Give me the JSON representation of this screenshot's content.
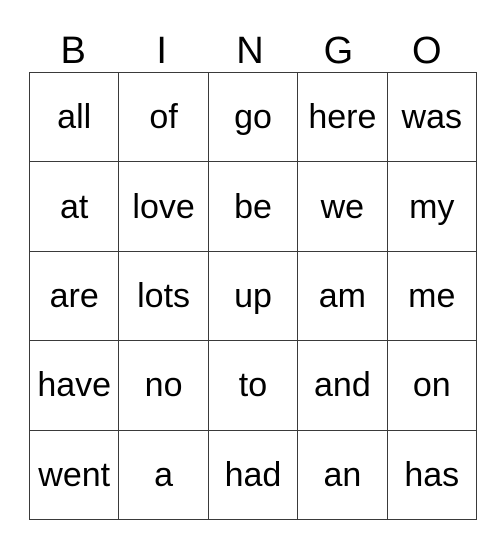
{
  "card": {
    "title": "BINGO",
    "column_headers": [
      "B",
      "I",
      "N",
      "G",
      "O"
    ],
    "rows": [
      [
        "all",
        "of",
        "go",
        "here",
        "was"
      ],
      [
        "at",
        "love",
        "be",
        "we",
        "my"
      ],
      [
        "are",
        "lots",
        "up",
        "am",
        "me"
      ],
      [
        "have",
        "no",
        "to",
        "and",
        "on"
      ],
      [
        "went",
        "a",
        "had",
        "an",
        "has"
      ]
    ],
    "grid_size": "5x5",
    "colors": {
      "background": "#ffffff",
      "text": "#000000",
      "border": "#3a3a3a"
    }
  }
}
